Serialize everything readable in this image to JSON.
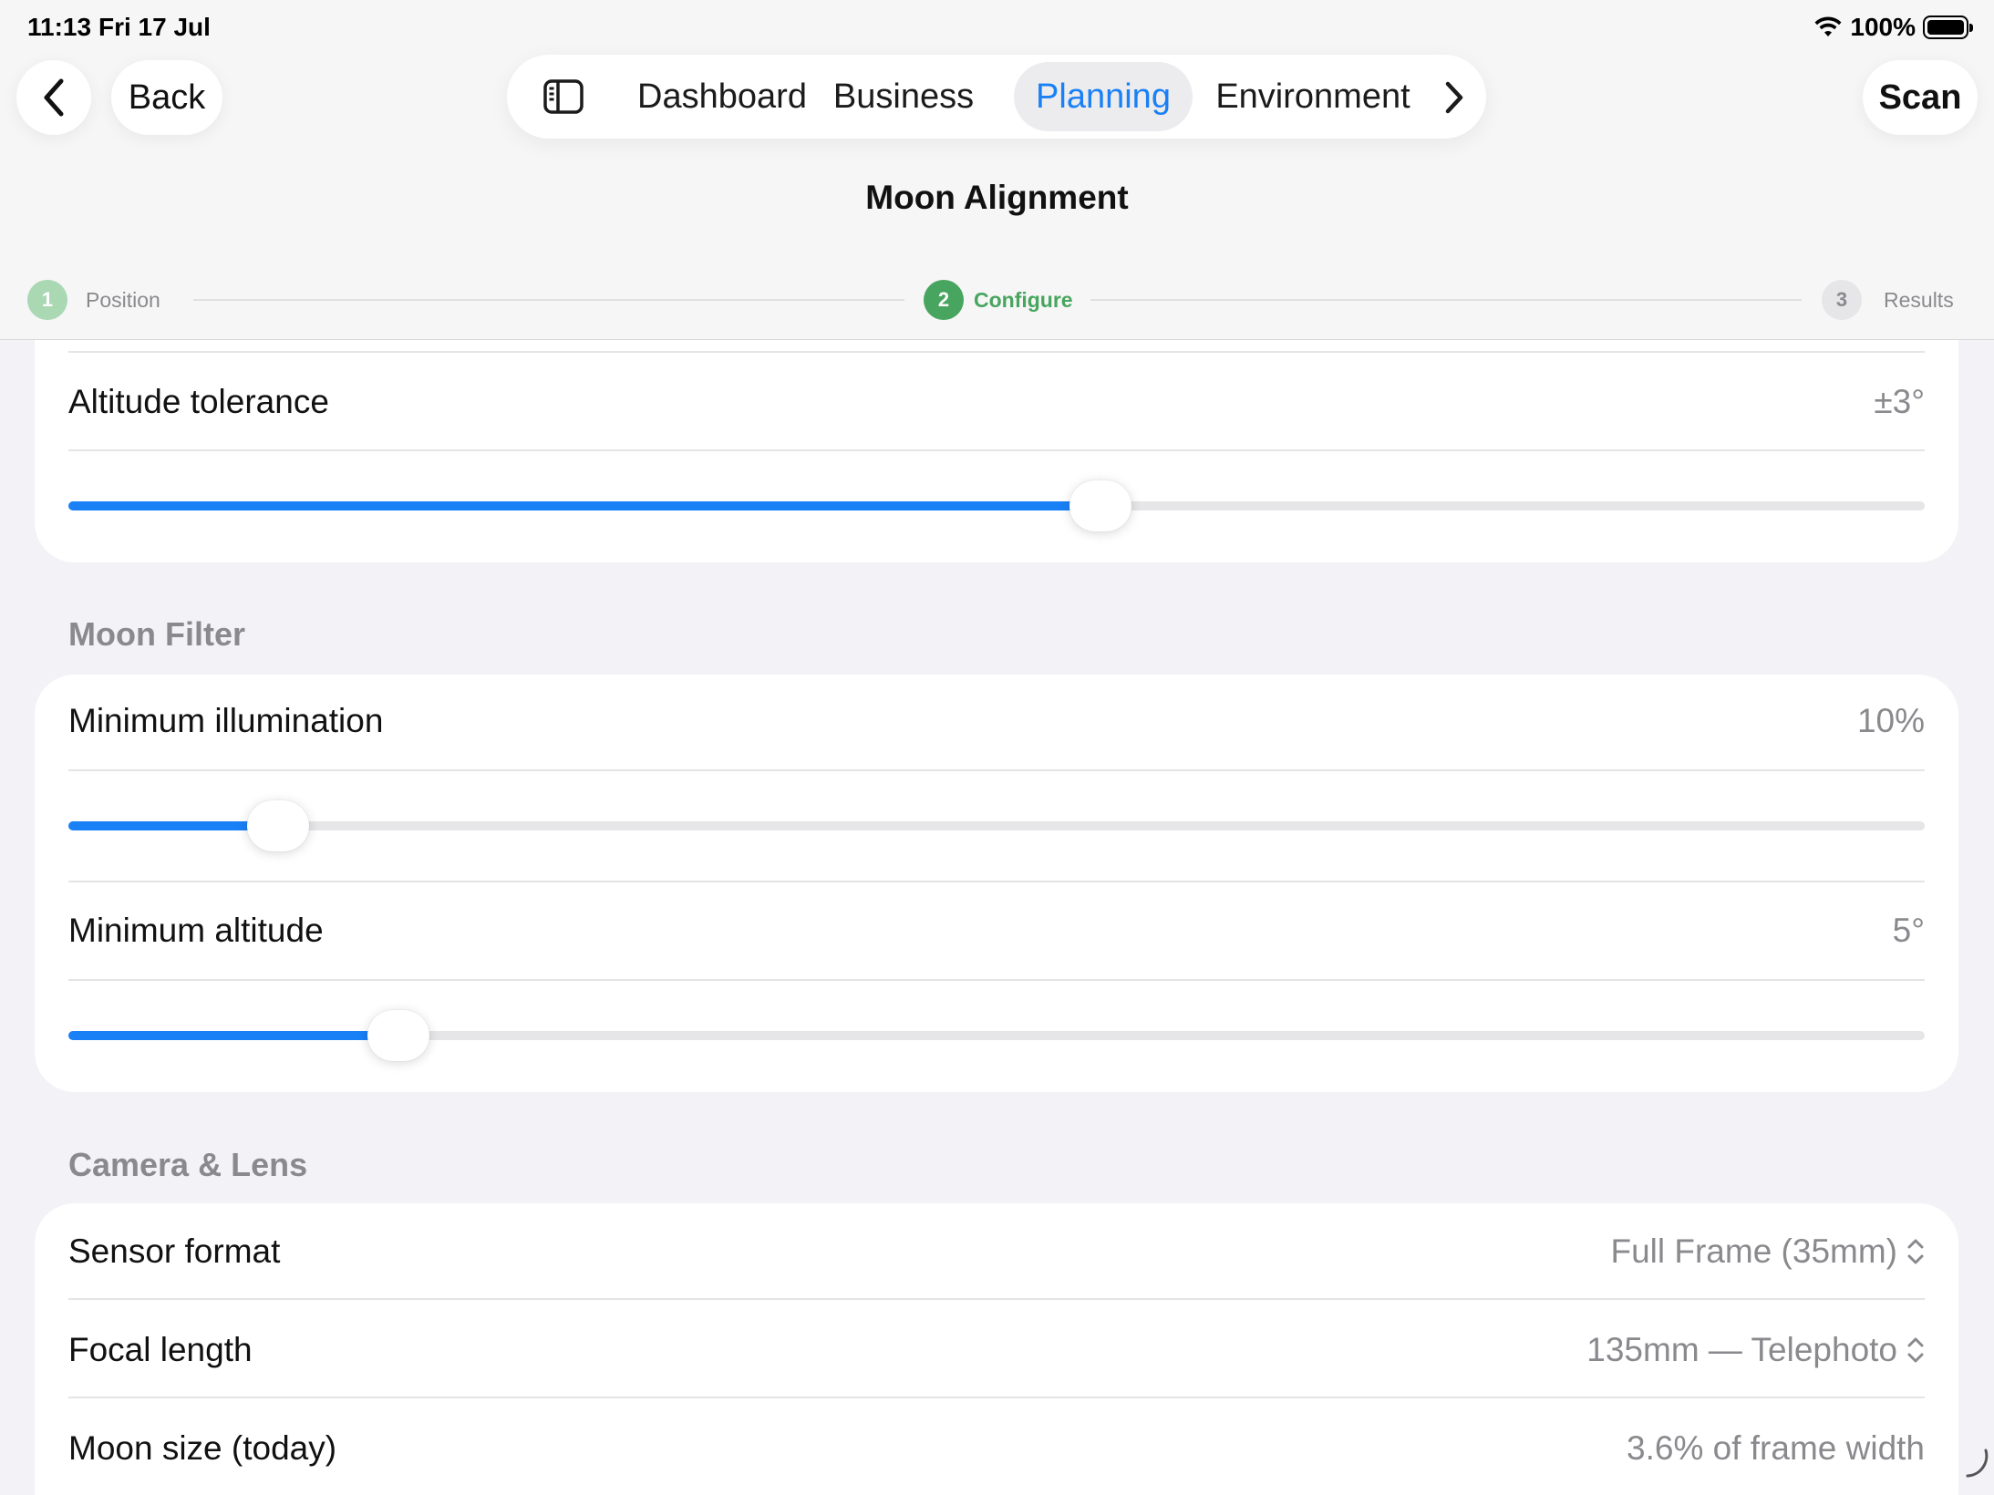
{
  "status": {
    "time": "11:13",
    "date": "Fri 17 Jul",
    "battery": "100%"
  },
  "nav": {
    "back_label": "Back",
    "tabs": [
      {
        "label": "Dashboard"
      },
      {
        "label": "Business"
      },
      {
        "label": "Planning"
      },
      {
        "label": "Environment"
      }
    ],
    "active_tab": "Planning",
    "scan_label": "Scan"
  },
  "page": {
    "title": "Moon Alignment"
  },
  "stepper": {
    "steps": [
      {
        "number": "1",
        "label": "Position",
        "state": "done"
      },
      {
        "number": "2",
        "label": "Configure",
        "state": "current"
      },
      {
        "number": "3",
        "label": "Results",
        "state": "pending"
      }
    ]
  },
  "alignment": {
    "altitude_tolerance": {
      "label": "Altitude tolerance",
      "value": "±3°",
      "slider_fraction": 0.556
    }
  },
  "moon_filter": {
    "header": "Moon Filter",
    "min_illumination": {
      "label": "Minimum illumination",
      "value": "10%",
      "slider_fraction": 0.113
    },
    "min_altitude": {
      "label": "Minimum altitude",
      "value": "5°",
      "slider_fraction": 0.178
    }
  },
  "camera_lens": {
    "header": "Camera & Lens",
    "sensor_format": {
      "label": "Sensor format",
      "value": "Full Frame (35mm)"
    },
    "focal_length": {
      "label": "Focal length",
      "value": "135mm — Telephoto"
    },
    "moon_size": {
      "label": "Moon size (today)",
      "value": "3.6% of frame width"
    }
  },
  "colors": {
    "accent": "#1a80f5",
    "step_done": "#a9d8b3",
    "step_current": "#48a55f",
    "step_pending": "#e6e6e8"
  }
}
